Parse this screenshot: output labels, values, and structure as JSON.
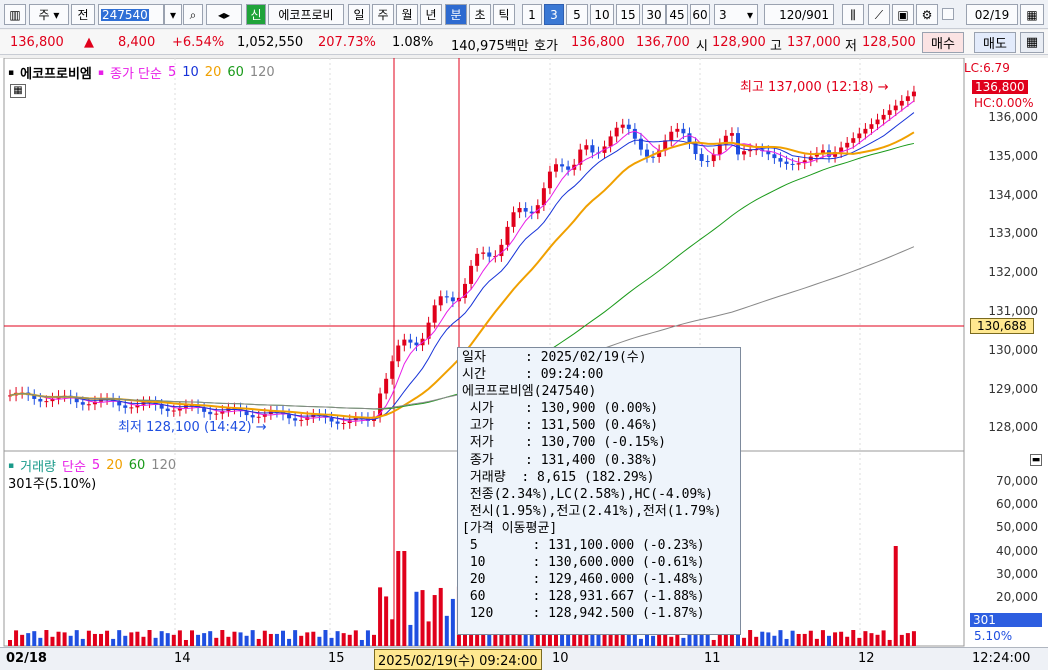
{
  "toolbar": {
    "market": "주",
    "code_mode": "전",
    "code": "247540",
    "new_badge": "신",
    "name": "에코프로비",
    "periods": [
      "일",
      "주",
      "월",
      "년"
    ],
    "period_selected": "분",
    "units": [
      "초",
      "틱"
    ],
    "minutes": [
      "1",
      "3",
      "5",
      "10",
      "15",
      "30",
      "45",
      "60"
    ],
    "minute_selected": "3",
    "interval_value": "3",
    "count": "120",
    "total": "/901",
    "date": "02/19",
    "date_checkbox": ""
  },
  "quote": {
    "price": "136,800",
    "arrow": "▲",
    "change": "8,400",
    "change_pct": "+6.54%",
    "volume": "1,052,550",
    "vol_ratio": "207.73%",
    "turnover": "1.08%",
    "amount": "140,975백만",
    "ask_label": "호가",
    "ask": "136,800",
    "bid": "136,700",
    "open_label": "시",
    "open": "128,900",
    "high_label": "고",
    "high": "137,000",
    "low_label": "저",
    "low": "128,500",
    "buy": "매수",
    "sell": "매도",
    "grid": "▦"
  },
  "price_panel": {
    "title": "에코프로비엠",
    "ma_label": "종가 단순",
    "ma": [
      "5",
      "10",
      "20",
      "60",
      "120"
    ],
    "high_note": "최고 137,000 (12:18)",
    "low_note": "최저 128,100 (14:42)",
    "lc": "LC:6.79",
    "hc": "HC:0.00%",
    "current": "136,800",
    "cursor_price": "130,688",
    "yticks": [
      "136,000",
      "135,000",
      "134,000",
      "133,000",
      "132,000",
      "131,000",
      "130,000",
      "129,000",
      "128,000"
    ]
  },
  "volume_panel": {
    "title": "거래량",
    "ma_label": "단순",
    "ma": [
      "5",
      "20",
      "60",
      "120"
    ],
    "sub": "301주(5.10%)",
    "current": "301",
    "current_pct": "5.10%",
    "yticks": [
      "70,000",
      "60,000",
      "50,000",
      "40,000",
      "30,000",
      "20,000"
    ]
  },
  "xaxis": {
    "labels": [
      "02/18",
      "14",
      "15",
      "10",
      "11",
      "12"
    ],
    "cursor": "2025/02/19(수) 09:24:00",
    "last": "12:24:00"
  },
  "tooltip": {
    "lines": [
      "일자     : 2025/02/19(수)",
      "시간     : 09:24:00",
      "에코프로비엠(247540)",
      " 시가    : 130,900 (0.00%)",
      " 고가    : 131,500 (0.46%)",
      " 저가    : 130,700 (-0.15%)",
      " 종가    : 131,400 (0.38%)",
      " 거래량  : 8,615 (182.29%)",
      " 전종(2.34%),LC(2.58%),HC(-4.09%)",
      " 전시(1.95%),전고(2.41%),전저(1.79%)",
      "[가격 이동평균]",
      " 5       : 131,100.000 (-0.23%)",
      " 10      : 130,600.000 (-0.61%)",
      " 20      : 129,460.000 (-1.48%)",
      " 60      : 128,931.667 (-1.88%)",
      " 120     : 128,942.500 (-1.87%)"
    ]
  },
  "colors": {
    "up": "#e0001b",
    "down": "#1f4fe0",
    "ma5": "#e81ee8",
    "ma10": "#1733d8",
    "ma20": "#f0a000",
    "ma60": "#1a9a1a",
    "ma120": "#888888"
  }
}
